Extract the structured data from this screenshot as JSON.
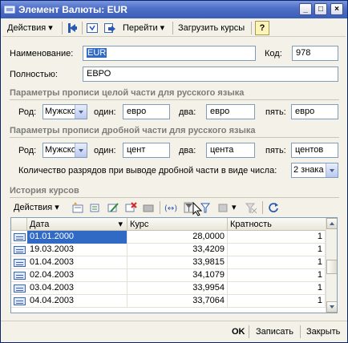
{
  "window": {
    "title": "Элемент Валюты: EUR",
    "buttons": {
      "minimize": "_",
      "maximize": "□",
      "close": "×"
    }
  },
  "toolbar": {
    "actions": "Действия",
    "goto": "Перейти",
    "load_rates": "Загрузить курсы",
    "help": "?"
  },
  "form": {
    "name_label": "Наименование:",
    "name_value": "EUR",
    "code_label": "Код:",
    "code_value": "978",
    "full_label": "Полностью:",
    "full_value": "ЕВРО"
  },
  "section_int": {
    "title": "Параметры прописи целой части для русского языка",
    "gender_label": "Род:",
    "gender_value": "Мужско",
    "one_label": "один:",
    "one_value": "евро",
    "two_label": "два:",
    "two_value": "евро",
    "five_label": "пять:",
    "five_value": "евро"
  },
  "section_frac": {
    "title": "Параметры прописи дробной части для русского языка",
    "gender_label": "Род:",
    "gender_value": "Мужско",
    "one_label": "один:",
    "one_value": "цент",
    "two_label": "два:",
    "two_value": "цента",
    "five_label": "пять:",
    "five_value": "центов",
    "digits_label": "Количество разрядов при выводе дробной части в виде числа:",
    "digits_value": "2 знака"
  },
  "history": {
    "title": "История курсов",
    "actions": "Действия",
    "columns": [
      "Дата",
      "Курс",
      "Кратность"
    ],
    "rows": [
      {
        "date": "01.01.2000",
        "rate": "28,0000",
        "mult": "1"
      },
      {
        "date": "19.03.2003",
        "rate": "33,4209",
        "mult": "1"
      },
      {
        "date": "01.04.2003",
        "rate": "33,9815",
        "mult": "1"
      },
      {
        "date": "02.04.2003",
        "rate": "34,1079",
        "mult": "1"
      },
      {
        "date": "03.04.2003",
        "rate": "33,9954",
        "mult": "1"
      },
      {
        "date": "04.04.2003",
        "rate": "33,7064",
        "mult": "1"
      }
    ]
  },
  "footer": {
    "ok": "OK",
    "save": "Записать",
    "close": "Закрыть"
  },
  "colors": {
    "title_bar": "#3a5db8",
    "selection": "#316ac5",
    "window_bg": "#f4f2e8"
  }
}
